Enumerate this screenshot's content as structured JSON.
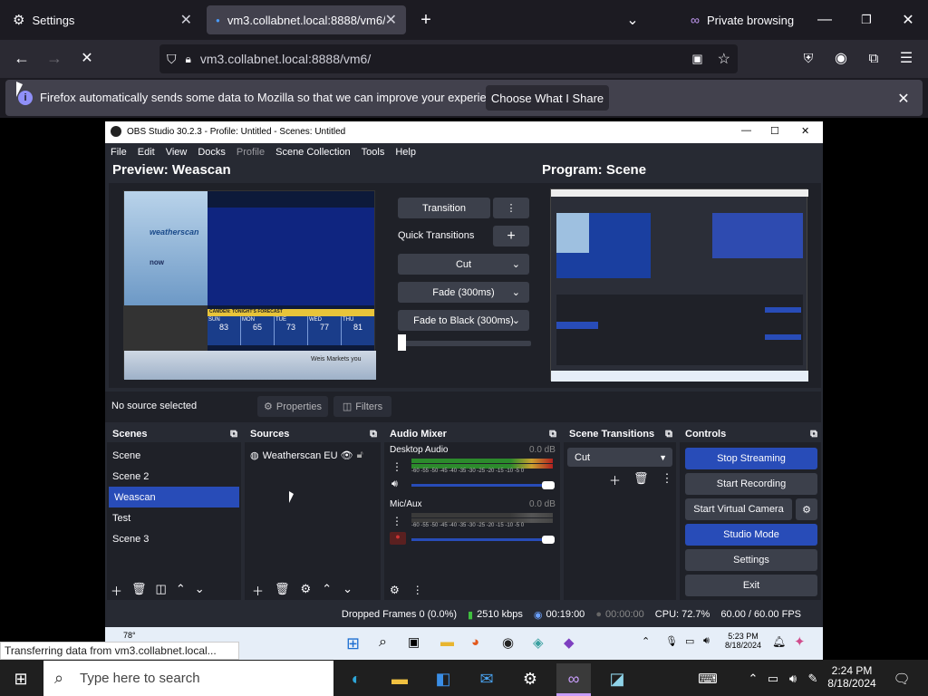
{
  "browser": {
    "tabs": [
      {
        "label": "Settings"
      },
      {
        "label": "vm3.collabnet.local:8888/vm6/"
      }
    ],
    "private_label": "Private browsing",
    "url": "vm3.collabnet.local:8888/vm6/",
    "notification": {
      "text": "Firefox automatically sends some data to Mozilla so that we can improve your experience.",
      "button": "Choose What I Share"
    },
    "status_text": "Transferring data from vm3.collabnet.local..."
  },
  "obs": {
    "title": "OBS Studio 30.2.3 - Profile: Untitled - Scenes: Untitled",
    "menu": [
      "File",
      "Edit",
      "View",
      "Docks",
      "Profile",
      "Scene Collection",
      "Tools",
      "Help"
    ],
    "preview_title": "Preview: Weascan",
    "program_title": "Program: Scene",
    "transition_label": "Transition",
    "quick_transitions": "Quick Transitions",
    "transitions": [
      "Cut",
      "Fade (300ms)",
      "Fade to Black (300ms)"
    ],
    "no_source": "No source selected",
    "properties": "Properties",
    "filters": "Filters",
    "weather": {
      "brand": "weatherscan",
      "now": "now",
      "header": "CAMDEN: TONIGHT'S FORECAST",
      "days": [
        "SUN",
        "MON",
        "TUE",
        "WED",
        "THU"
      ],
      "temps": [
        "83",
        "65",
        "73",
        "77",
        "81"
      ],
      "ticker": "Weis Markets you"
    },
    "docks": {
      "scenes": {
        "title": "Scenes",
        "items": [
          "Scene",
          "Scene 2",
          "Weascan",
          "Test",
          "Scene 3"
        ],
        "selected": 2
      },
      "sources": {
        "title": "Sources",
        "items": [
          "Weatherscan EUN"
        ]
      },
      "mixer": {
        "title": "Audio Mixer",
        "channels": [
          {
            "name": "Desktop Audio",
            "db": "0.0 dB"
          },
          {
            "name": "Mic/Aux",
            "db": "0.0 dB"
          }
        ],
        "scale": "-60 -55 -50 -45 -40 -35 -30 -25 -20 -15 -10 -5 0"
      },
      "scene_transitions": {
        "title": "Scene Transitions",
        "value": "Cut"
      },
      "controls": {
        "title": "Controls",
        "buttons": [
          "Stop Streaming",
          "Start Recording",
          "Start Virtual Camera",
          "Studio Mode",
          "Settings",
          "Exit"
        ]
      }
    },
    "status": {
      "dropped": "Dropped Frames 0 (0.0%)",
      "bitrate": "2510 kbps",
      "stream_time": "00:19:00",
      "rec_time": "00:00:00",
      "cpu": "CPU: 72.7%",
      "fps": "60.00 / 60.00 FPS"
    },
    "inner_taskbar": {
      "weather": "78°",
      "time": "5:23 PM",
      "date": "8/18/2024"
    }
  },
  "taskbar": {
    "search_placeholder": "Type here to search",
    "time": "2:24 PM",
    "date": "8/18/2024"
  },
  "colors": {
    "accent": "#284cb8",
    "browser_bg": "#1c1b22",
    "obs_bg": "#272a33"
  }
}
